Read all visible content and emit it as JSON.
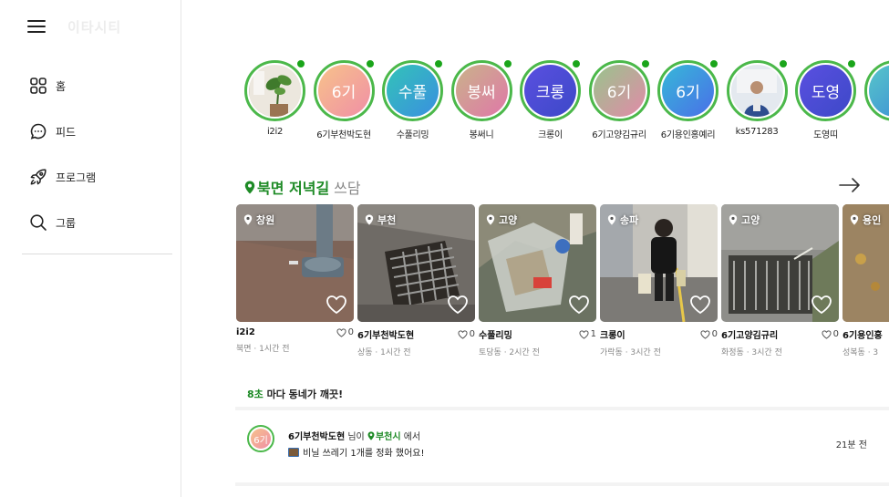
{
  "app": {
    "logo": "이타시티"
  },
  "sidebar": {
    "items": [
      {
        "label": "홈",
        "icon": "home-grid-icon"
      },
      {
        "label": "피드",
        "icon": "chat-bubble-icon"
      },
      {
        "label": "프로그램",
        "icon": "rocket-icon"
      },
      {
        "label": "그룹",
        "icon": "search-icon"
      }
    ]
  },
  "stories": [
    {
      "name": "i2i2",
      "avatar_text": "",
      "type": "photo",
      "colors": [
        "#e9e4dc",
        "#3f7a2c"
      ]
    },
    {
      "name": "6기부천박도현",
      "avatar_text": "6기",
      "colors": [
        "#f7c28a",
        "#f08fa6"
      ]
    },
    {
      "name": "수풀리밍",
      "avatar_text": "수풀",
      "colors": [
        "#33c3b8",
        "#3a8fe0"
      ]
    },
    {
      "name": "봉써니",
      "avatar_text": "봉써",
      "colors": [
        "#c9b38a",
        "#e077a8"
      ]
    },
    {
      "name": "크롱이",
      "avatar_text": "크롱",
      "colors": [
        "#5a4fe0",
        "#3d49c8"
      ]
    },
    {
      "name": "6기고양김규리",
      "avatar_text": "6기",
      "colors": [
        "#98c48c",
        "#e28aa8"
      ]
    },
    {
      "name": "6기용인홍예리",
      "avatar_text": "6기",
      "colors": [
        "#36b8d8",
        "#4a6fe8"
      ]
    },
    {
      "name": "ks571283",
      "avatar_text": "",
      "type": "photo",
      "colors": [
        "#dfe6ee",
        "#2e4e8e"
      ]
    },
    {
      "name": "도영띠",
      "avatar_text": "도영",
      "colors": [
        "#5a4fe0",
        "#3d49c8"
      ]
    },
    {
      "name": "",
      "avatar_text": "",
      "colors": [
        "#57c6c9",
        "#3b88d8"
      ]
    }
  ],
  "section": {
    "title_green": "북면 저녁길",
    "title_grey": "쓰담"
  },
  "cards": [
    {
      "location": "창원",
      "user": "i2i2",
      "likes": "0",
      "meta": "북면 · 1시간 전",
      "colors": [
        "#8a6a5e",
        "#5a4a44"
      ]
    },
    {
      "location": "부천",
      "user": "6기부천박도현",
      "likes": "0",
      "meta": "상동 · 1시간 전",
      "colors": [
        "#7a7874",
        "#46443f"
      ]
    },
    {
      "location": "고양",
      "user": "수풀리밍",
      "likes": "1",
      "meta": "토당동 · 2시간 전",
      "colors": [
        "#b4ab8e",
        "#5d6a58"
      ]
    },
    {
      "location": "송파",
      "user": "크롱이",
      "likes": "0",
      "meta": "가락동 · 3시간 전",
      "colors": [
        "#b6b4ae",
        "#3a3a3a"
      ]
    },
    {
      "location": "고양",
      "user": "6기고양김규리",
      "likes": "0",
      "meta": "화정동 · 3시간 전",
      "colors": [
        "#8e8e8a",
        "#4c4c48"
      ]
    },
    {
      "location": "용인",
      "user": "6기용인홍",
      "likes": "",
      "meta": "성복동 · 3",
      "colors": [
        "#9a8060",
        "#5a4e38"
      ]
    }
  ],
  "clean": {
    "highlight": "8초",
    "text": " 마다 동네가 깨끗!"
  },
  "feed": [
    {
      "avatar_text": "6기",
      "user": "6기부천박도현",
      "mid": " 님이 ",
      "place": "부천시",
      "suffix": " 에서",
      "action": "비닐 쓰레기 1개를 정화 했어요!",
      "time": "21분 전"
    }
  ]
}
